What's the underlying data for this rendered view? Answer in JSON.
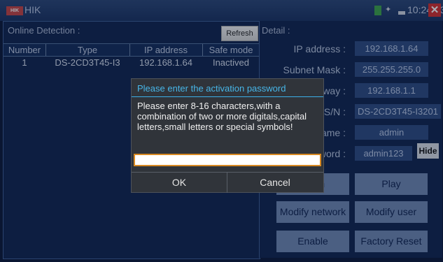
{
  "app": {
    "logo_text": "HIK",
    "title": "HIK",
    "time": "10:24:03"
  },
  "left": {
    "title": "Online Detection :",
    "refresh_label": "Refresh",
    "headers": [
      "Number",
      "Type",
      "IP address",
      "Safe mode"
    ],
    "rows": [
      [
        "1",
        "DS-2CD3T45-I3",
        "192.168.1.64",
        "Inactived"
      ]
    ]
  },
  "detail": {
    "title": "Detail :",
    "labels": [
      "IP address :",
      "Subnet Mask :",
      "Gateway :",
      "S/N :",
      "Username :",
      "Password :"
    ],
    "values": [
      "192.168.1.64",
      "255.255.255.0",
      "192.168.1.1",
      "DS-2CD3T45-I3201",
      "admin",
      "admin123"
    ],
    "hide_label": "Hide",
    "buttons": [
      "Login",
      "Play",
      "Modify network",
      "Modify user",
      "Enable",
      "Factory Reset"
    ]
  },
  "dialog": {
    "title": "Please enter the activation password",
    "message": "Please enter 8-16 characters,with a combination of two or more digitals,capital letters,small letters or special symbols!",
    "input_value": "",
    "ok_label": "OK",
    "cancel_label": "Cancel"
  }
}
